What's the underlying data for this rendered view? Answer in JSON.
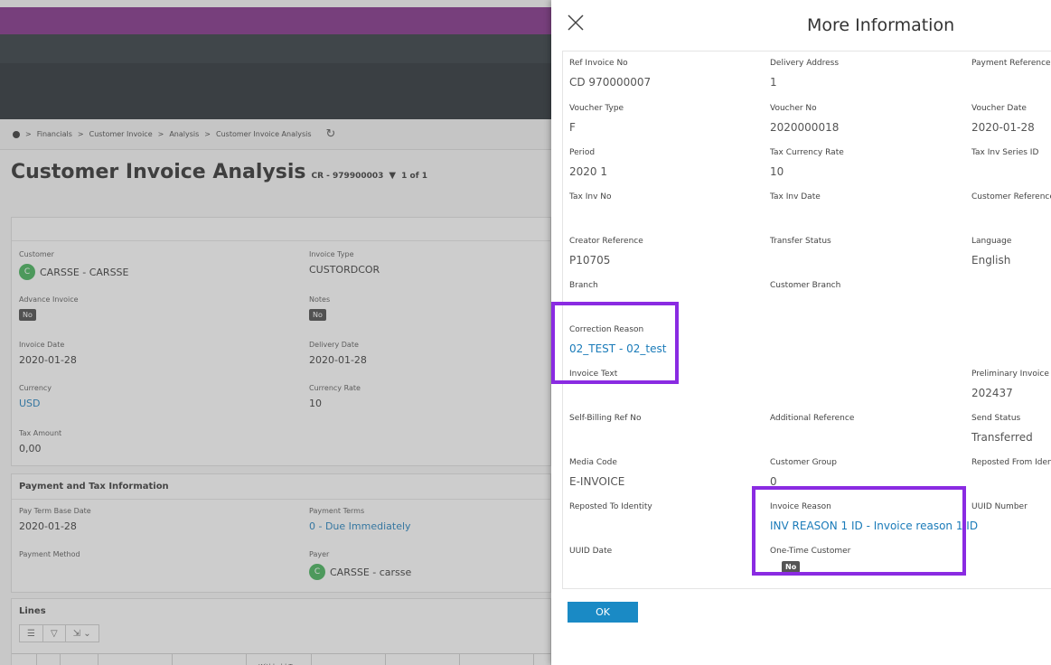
{
  "background": {
    "breadcrumb": [
      "Financials",
      "Customer Invoice",
      "Analysis",
      "Customer Invoice Analysis"
    ],
    "page_title": "Customer Invoice Analysis",
    "record_ref": "CR - 979900003",
    "record_count": "1 of 1",
    "fields": {
      "customer_label": "Customer",
      "customer_avatar": "C",
      "customer_value": "CARSSE - CARSSE",
      "invoice_type_label": "Invoice Type",
      "invoice_type_value": "CUSTORDCOR",
      "advance_invoice_label": "Advance Invoice",
      "advance_invoice_value": "No",
      "notes_label": "Notes",
      "notes_value": "No",
      "invoice_date_label": "Invoice Date",
      "invoice_date_value": "2020-01-28",
      "delivery_date_label": "Delivery Date",
      "delivery_date_value": "2020-01-28",
      "currency_label": "Currency",
      "currency_value": "USD",
      "currency_rate_label": "Currency Rate",
      "currency_rate_value": "10",
      "tax_amount_label": "Tax Amount",
      "tax_amount_value": "0,00"
    },
    "payment_section": {
      "title": "Payment and Tax Information",
      "pay_term_base_date_label": "Pay Term Base Date",
      "pay_term_base_date_value": "2020-01-28",
      "payment_terms_label": "Payment Terms",
      "payment_terms_value": "0 - Due Immediately",
      "payment_method_label": "Payment Method",
      "payer_label": "Payer",
      "payer_avatar": "C",
      "payer_value": "CARSSE - carsse"
    },
    "lines_section": {
      "title": "Lines",
      "withheld_tax_header": "Withheld Tax"
    }
  },
  "modal": {
    "title": "More Information",
    "ok_label": "OK",
    "fields": {
      "ref_invoice_no": {
        "label": "Ref Invoice No",
        "value": "CD 970000007"
      },
      "delivery_address": {
        "label": "Delivery Address",
        "value": "1"
      },
      "payment_reference": {
        "label": "Payment Reference",
        "value": ""
      },
      "voucher_type": {
        "label": "Voucher Type",
        "value": "F"
      },
      "voucher_no": {
        "label": "Voucher No",
        "value": "2020000018"
      },
      "voucher_date": {
        "label": "Voucher Date",
        "value": "2020-01-28"
      },
      "period": {
        "label": "Period",
        "value": "2020 1"
      },
      "tax_currency_rate": {
        "label": "Tax Currency Rate",
        "value": "10"
      },
      "tax_inv_series_id": {
        "label": "Tax Inv Series ID",
        "value": ""
      },
      "tax_inv_no": {
        "label": "Tax Inv No",
        "value": ""
      },
      "tax_inv_date": {
        "label": "Tax Inv Date",
        "value": ""
      },
      "customer_reference": {
        "label": "Customer Reference",
        "value": ""
      },
      "creator_reference": {
        "label": "Creator Reference",
        "value": "P10705"
      },
      "transfer_status": {
        "label": "Transfer Status",
        "value": ""
      },
      "language": {
        "label": "Language",
        "value": "English"
      },
      "branch": {
        "label": "Branch",
        "value": ""
      },
      "customer_branch": {
        "label": "Customer Branch",
        "value": ""
      },
      "correction_reason": {
        "label": "Correction Reason",
        "value": "02_TEST - 02_test"
      },
      "invoice_text": {
        "label": "Invoice Text",
        "value": ""
      },
      "preliminary_invoice": {
        "label": "Preliminary Invoice N",
        "value": "202437"
      },
      "self_billing_ref_no": {
        "label": "Self-Billing Ref No",
        "value": ""
      },
      "additional_reference": {
        "label": "Additional Reference",
        "value": ""
      },
      "send_status": {
        "label": "Send Status",
        "value": "Transferred"
      },
      "media_code": {
        "label": "Media Code",
        "value": "E-INVOICE"
      },
      "customer_group": {
        "label": "Customer Group",
        "value": "0"
      },
      "reposted_from_identity": {
        "label": "Reposted From Iden",
        "value": ""
      },
      "reposted_to_identity": {
        "label": "Reposted To Identity",
        "value": ""
      },
      "invoice_reason": {
        "label": "Invoice Reason",
        "value": "INV REASON 1 ID - Invoice reason 1 ID"
      },
      "uuid_number": {
        "label": "UUID Number",
        "value": ""
      },
      "uuid_date": {
        "label": "UUID Date",
        "value": ""
      },
      "one_time_customer": {
        "label": "One-Time Customer",
        "value": "No"
      }
    }
  },
  "colors": {
    "highlight": "#8a2be2",
    "link": "#1a7bb9",
    "ok_button": "#1a8ac5",
    "brand_bar": "#7d2a83"
  }
}
